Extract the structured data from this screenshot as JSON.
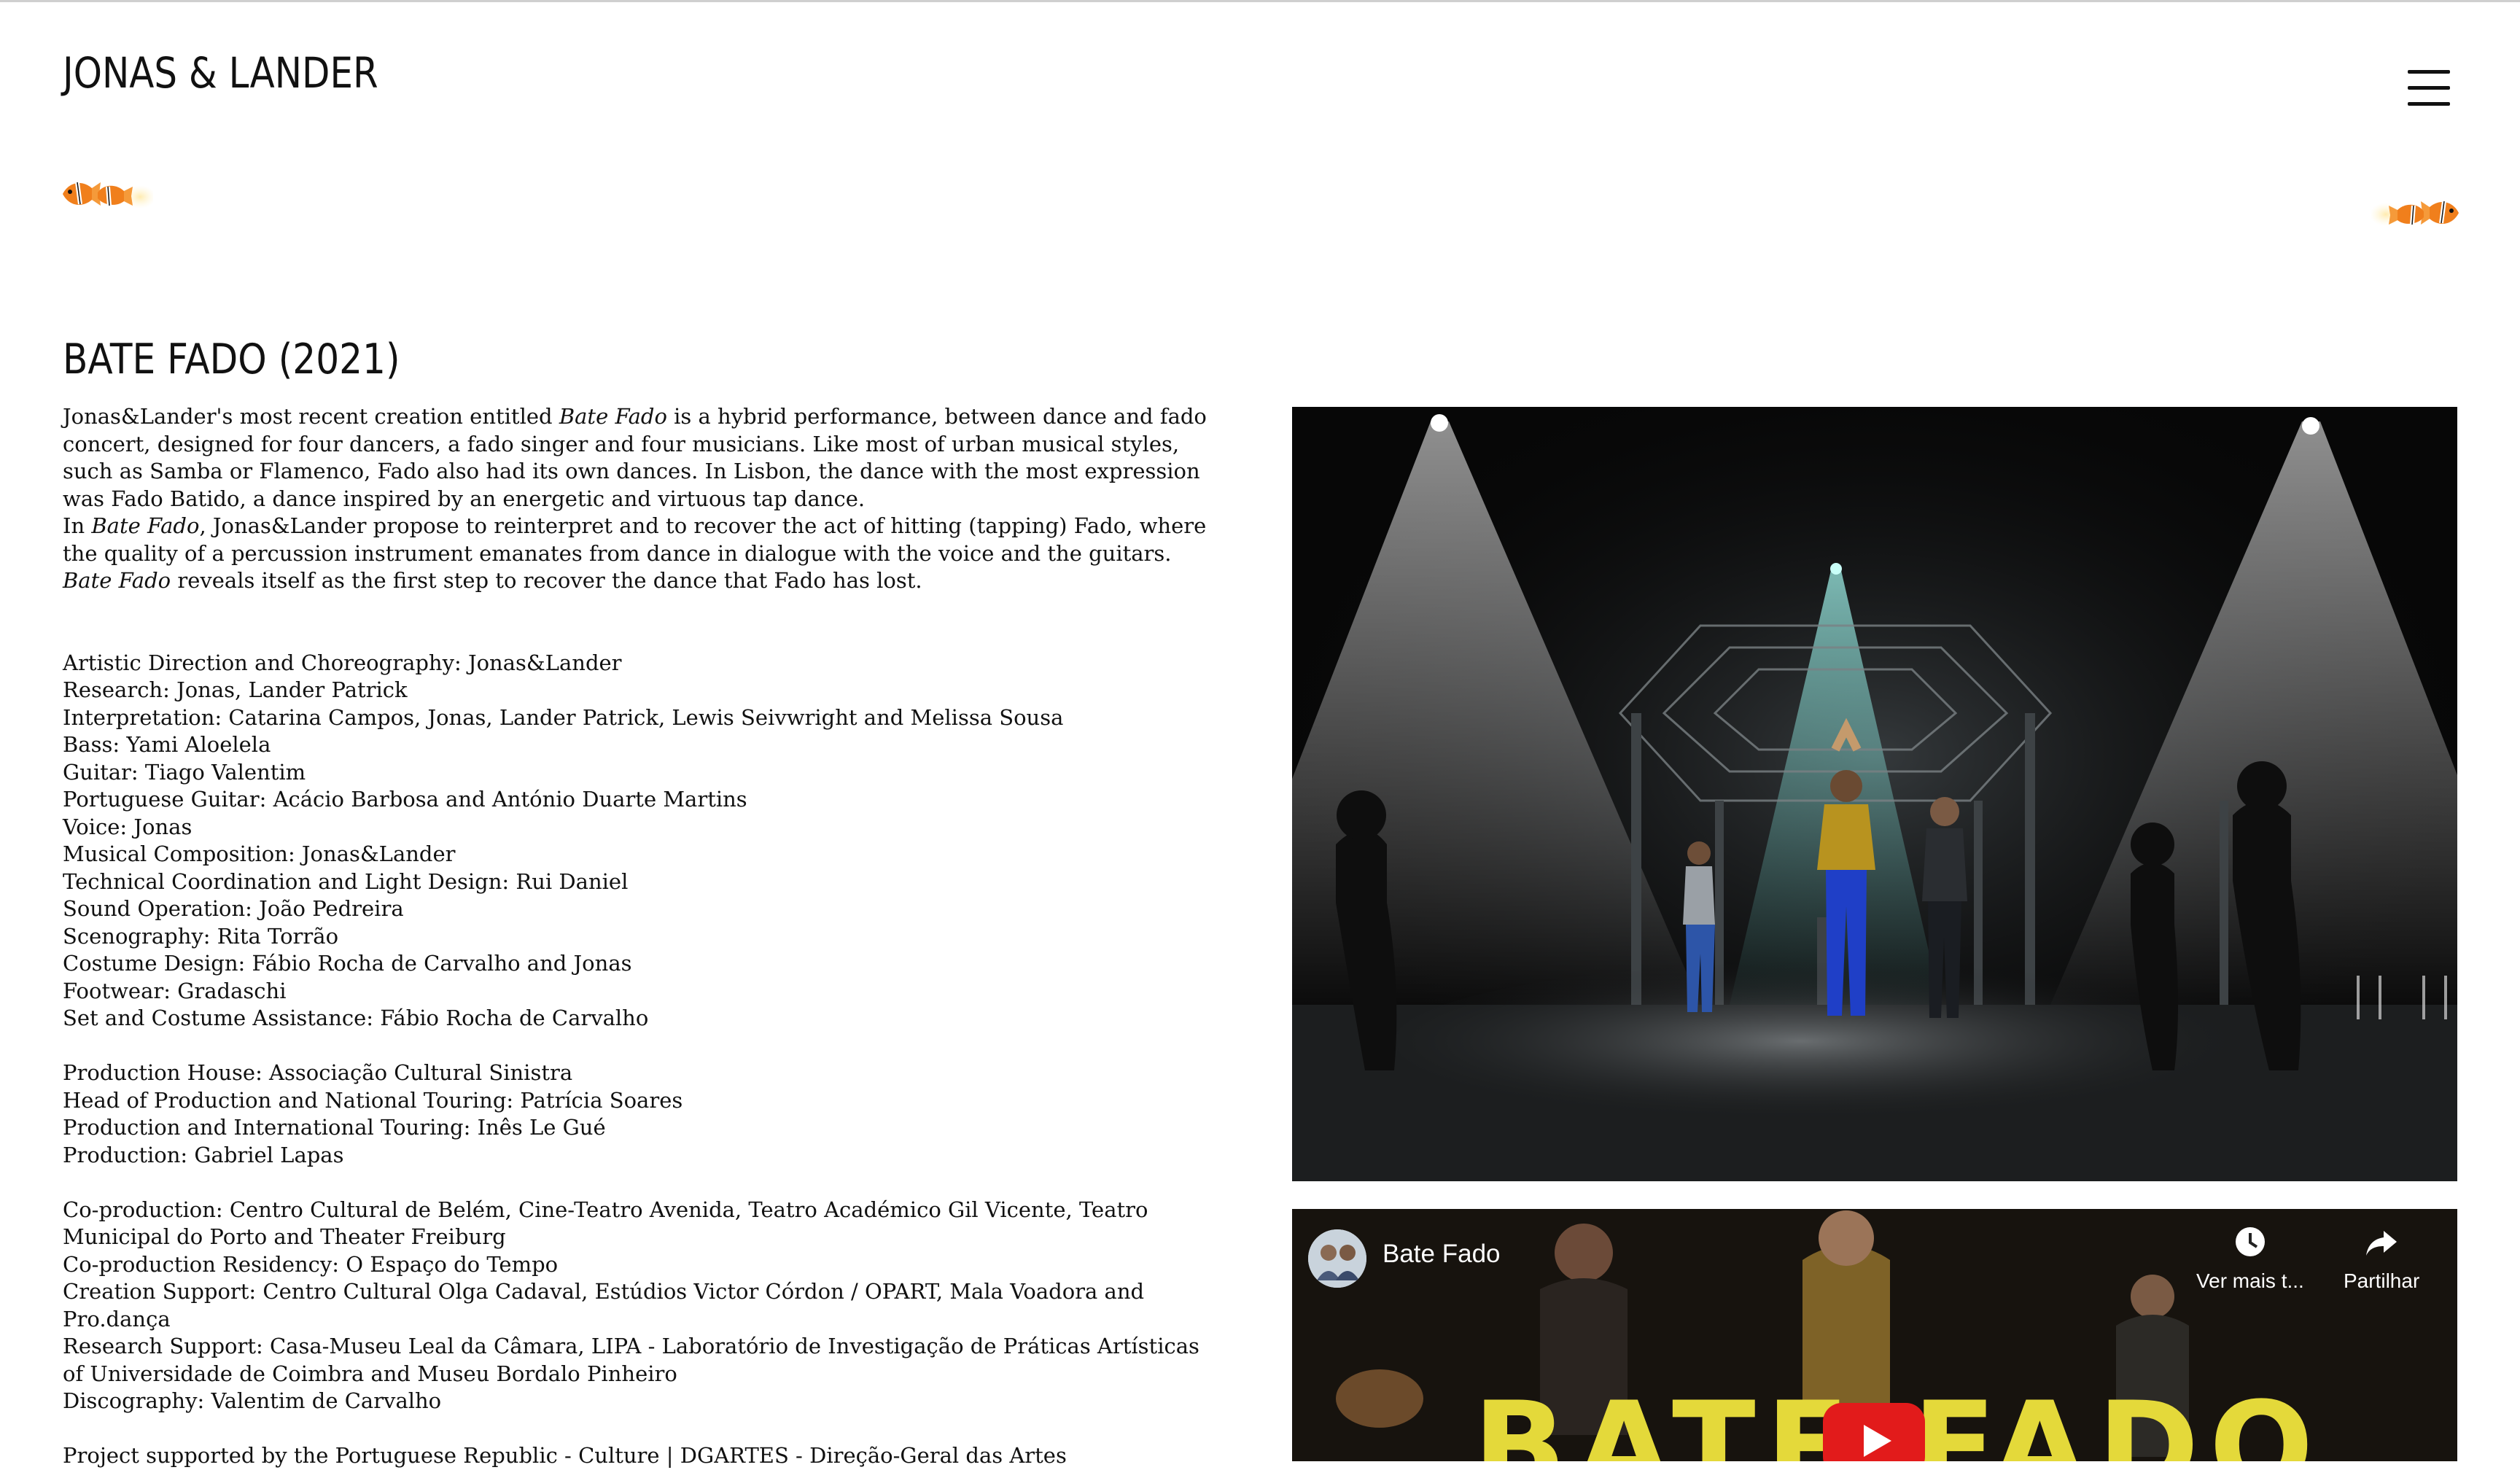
{
  "header": {
    "brand": "JONAS & LANDER"
  },
  "icons": {
    "menu": "hamburger-menu-icon",
    "decor_left": "clownfish-icon",
    "decor_right": "clownfish-icon"
  },
  "main": {
    "title": "BATE FADO (2021)",
    "paragraphs": [
      [
        "Jonas&Lander's most recent creation entitled ",
        {
          "em": "Bate Fado"
        },
        " is a hybrid performance, between dance and fado"
      ],
      [
        "concert, designed for four dancers, a fado singer and four musicians. Like most of urban musical styles,"
      ],
      [
        "such as Samba or Flamenco, Fado also had its own dances. In Lisbon, the dance with the most expression"
      ],
      [
        "was Fado Batido, a dance inspired by an energetic and virtuous tap dance."
      ],
      [
        "In ",
        {
          "em": "Bate Fado"
        },
        ", Jonas&Lander propose to reinterpret and to recover the act of hitting (tapping) Fado, where"
      ],
      [
        "the quality of a percussion instrument emanates from dance in dialogue with the voice and the guitars."
      ],
      [
        {
          "em": "Bate Fado"
        },
        " reveals itself as the first step to recover the dance that Fado has lost."
      ]
    ],
    "credits": [
      "Artistic Direction and Choreography: Jonas&Lander",
      "Research: Jonas, Lander Patrick",
      "Interpretation: Catarina Campos, Jonas, Lander Patrick, Lewis Seivwright and Melissa Sousa",
      "Bass: Yami Aloelela",
      "Guitar: Tiago Valentim",
      "Portuguese Guitar: Acácio Barbosa and António Duarte Martins",
      "Voice: Jonas",
      "Musical Composition: Jonas&Lander",
      "Technical Coordination and Light Design: Rui Daniel",
      "Sound Operation: João Pedreira",
      "Scenography: Rita Torrão",
      "Costume Design: Fábio Rocha de Carvalho and Jonas",
      "Footwear: Gradaschi",
      "Set and Costume Assistance: Fábio Rocha de Carvalho"
    ],
    "production": [
      "Production House: Associação Cultural Sinistra",
      "Head of Production and National Touring: Patrícia Soares",
      "Production and International Touring: Inês Le Gué",
      "Production: Gabriel Lapas"
    ],
    "support": [
      "Co-production: Centro Cultural de Belém, Cine-Teatro Avenida, Teatro Académico Gil Vicente, Teatro",
      "Municipal do Porto and Theater Freiburg",
      "Co-production Residency: O Espaço do Tempo",
      "Creation Support: Centro Cultural Olga Cadaval, Estúdios Victor Córdon / OPART, Mala Voadora and",
      "Pro.dança",
      "Research Support: Casa-Museu Leal da Câmara, LIPA - Laboratório de Investigação de Práticas Artísticas",
      "of Universidade de Coimbra and Museu Bordalo Pinheiro",
      "Discography: Valentim de Carvalho"
    ],
    "footer_line": "Project supported by the Portuguese Republic - Culture | DGARTES - Direção-Geral das Artes"
  },
  "video": {
    "title": "Bate Fado",
    "watch_later": "Ver mais t...",
    "share": "Partilhar",
    "thumbnail_text": "BATE FADO",
    "colors": {
      "thumbnail_text": "#e4d93a",
      "play": "#e21b1b"
    }
  }
}
